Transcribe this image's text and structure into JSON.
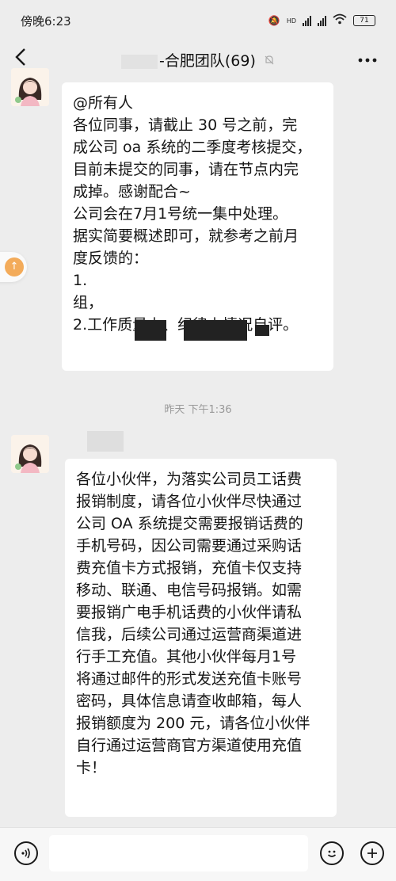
{
  "status_bar": {
    "time": "傍晚6:23",
    "network": "HD",
    "battery": "71"
  },
  "header": {
    "title": "-合肥团队(69)",
    "back_icon": "chevron-left-icon",
    "mute_icon": "bell-off-icon",
    "more_icon": "ellipsis-icon"
  },
  "messages": [
    {
      "lines": [
        "@所有人",
        "各位同事，请截止 30 号之前，完",
        "成公司 oa 系统的二季度考核提交，",
        "目前未提交的同事，请在节点内完",
        "成掉。感谢配合~",
        "公司会在7月1号统一集中处理。",
        "据实简要概述即可，就参考之前月",
        "度反馈的：",
        "1.",
        "组，",
        "2.工作质量上、纪律上情况自评。"
      ],
      "partial": [
        "评。"
      ]
    },
    {
      "lines": [
        "各位小伙伴，为落实公司员工话费",
        "报销制度，请各位小伙伴尽快通过",
        "公司 OA 系统提交需要报销话费的",
        "手机号码，因公司需要通过采购话",
        "费充值卡方式报销，充值卡仅支持",
        "移动、联通、电信号码报销。如需",
        "要报销广电手机话费的小伙伴请私",
        "信我，后续公司通过运营商渠道进",
        "行手工充值。其他小伙伴每月1号",
        "将通过邮件的形式发送充值卡账号",
        "密码，具体信息请查收邮箱，每人",
        "报销额度为 200 元，请各位小伙伴",
        "自行通过运营商官方渠道使用充值",
        "卡！"
      ]
    }
  ],
  "timestamp": "昨天 下午1:36",
  "input_bar": {
    "voice_icon": "voice-icon",
    "emoji_icon": "emoji-icon",
    "add_icon": "plus-icon"
  }
}
